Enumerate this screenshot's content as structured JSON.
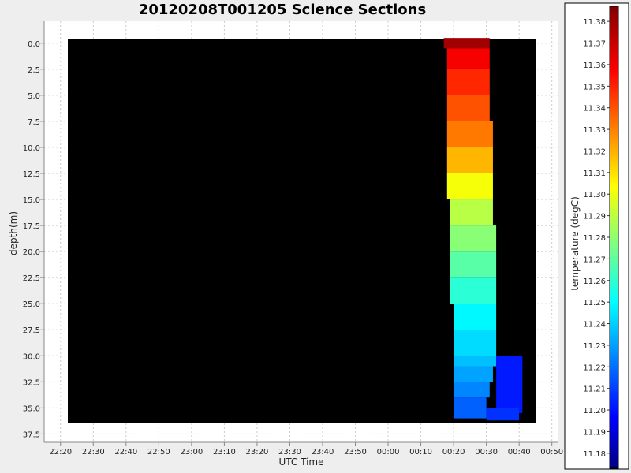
{
  "chart_data": {
    "type": "heatmap",
    "title": "20120208T001205 Science Sections",
    "xlabel": "UTC Time",
    "ylabel": "depth(m)",
    "x_ticks": [
      "22:20",
      "22:30",
      "22:40",
      "22:50",
      "23:00",
      "23:10",
      "23:20",
      "23:30",
      "23:40",
      "23:50",
      "00:00",
      "00:10",
      "00:20",
      "00:30",
      "00:40",
      "00:50"
    ],
    "y_ticks": [
      "0.0",
      "2.5",
      "5.0",
      "7.5",
      "10.0",
      "12.5",
      "15.0",
      "17.5",
      "20.0",
      "22.5",
      "25.0",
      "27.5",
      "30.0",
      "32.5",
      "35.0",
      "37.5"
    ],
    "xlim_minutes_of_day": [
      1335,
      1492
    ],
    "ylim": [
      38.3,
      -2.1
    ],
    "plot_background": "#000000",
    "grid": true,
    "colorbar": {
      "label": "temperature (degC)",
      "ticks": [
        "11.38",
        "11.37",
        "11.36",
        "11.35",
        "11.34",
        "11.33",
        "11.32",
        "11.31",
        "11.30",
        "11.29",
        "11.28",
        "11.27",
        "11.26",
        "11.25",
        "11.24",
        "11.23",
        "11.22",
        "11.21",
        "11.20",
        "11.19",
        "11.18"
      ],
      "min": 11.173,
      "max": 11.387,
      "colormap": "jet"
    },
    "sections": [
      {
        "depth_top": -0.5,
        "depth_bottom": 0.5,
        "time_start": "00:17",
        "time_end": "00:31",
        "temperature": 11.38
      },
      {
        "depth_top": 0.5,
        "depth_bottom": 2.5,
        "time_start": "00:18",
        "time_end": "00:31",
        "temperature": 11.362
      },
      {
        "depth_top": 2.5,
        "depth_bottom": 5.0,
        "time_start": "00:18",
        "time_end": "00:31",
        "temperature": 11.352
      },
      {
        "depth_top": 5.0,
        "depth_bottom": 7.5,
        "time_start": "00:18",
        "time_end": "00:31",
        "temperature": 11.343
      },
      {
        "depth_top": 7.5,
        "depth_bottom": 10.0,
        "time_start": "00:18",
        "time_end": "00:32",
        "temperature": 11.335
      },
      {
        "depth_top": 10.0,
        "depth_bottom": 12.5,
        "time_start": "00:18",
        "time_end": "00:32",
        "temperature": 11.322
      },
      {
        "depth_top": 12.5,
        "depth_bottom": 15.0,
        "time_start": "00:18",
        "time_end": "00:32",
        "temperature": 11.305
      },
      {
        "depth_top": 15.0,
        "depth_bottom": 17.5,
        "time_start": "00:19",
        "time_end": "00:32",
        "temperature": 11.292
      },
      {
        "depth_top": 17.5,
        "depth_bottom": 20.0,
        "time_start": "00:19",
        "time_end": "00:33",
        "temperature": 11.282
      },
      {
        "depth_top": 20.0,
        "depth_bottom": 22.5,
        "time_start": "00:19",
        "time_end": "00:33",
        "temperature": 11.272
      },
      {
        "depth_top": 22.5,
        "depth_bottom": 25.0,
        "time_start": "00:19",
        "time_end": "00:33",
        "temperature": 11.262
      },
      {
        "depth_top": 25.0,
        "depth_bottom": 27.5,
        "time_start": "00:20",
        "time_end": "00:33",
        "temperature": 11.252
      },
      {
        "depth_top": 27.5,
        "depth_bottom": 30.0,
        "time_start": "00:20",
        "time_end": "00:33",
        "temperature": 11.246
      },
      {
        "depth_top": 30.0,
        "depth_bottom": 31.0,
        "time_start": "00:20",
        "time_end": "00:33",
        "temperature": 11.24
      },
      {
        "depth_top": 31.0,
        "depth_bottom": 32.5,
        "time_start": "00:20",
        "time_end": "00:32",
        "temperature": 11.234
      },
      {
        "depth_top": 32.5,
        "depth_bottom": 34.0,
        "time_start": "00:20",
        "time_end": "00:31",
        "temperature": 11.228
      },
      {
        "depth_top": 34.0,
        "depth_bottom": 36.0,
        "time_start": "00:20",
        "time_end": "00:30",
        "temperature": 11.22
      },
      {
        "depth_top": 30.0,
        "depth_bottom": 35.5,
        "time_start": "00:33",
        "time_end": "00:41",
        "temperature": 11.205
      },
      {
        "depth_top": 35.0,
        "depth_bottom": 36.2,
        "time_start": "00:30",
        "time_end": "00:40",
        "temperature": 11.21
      }
    ]
  }
}
